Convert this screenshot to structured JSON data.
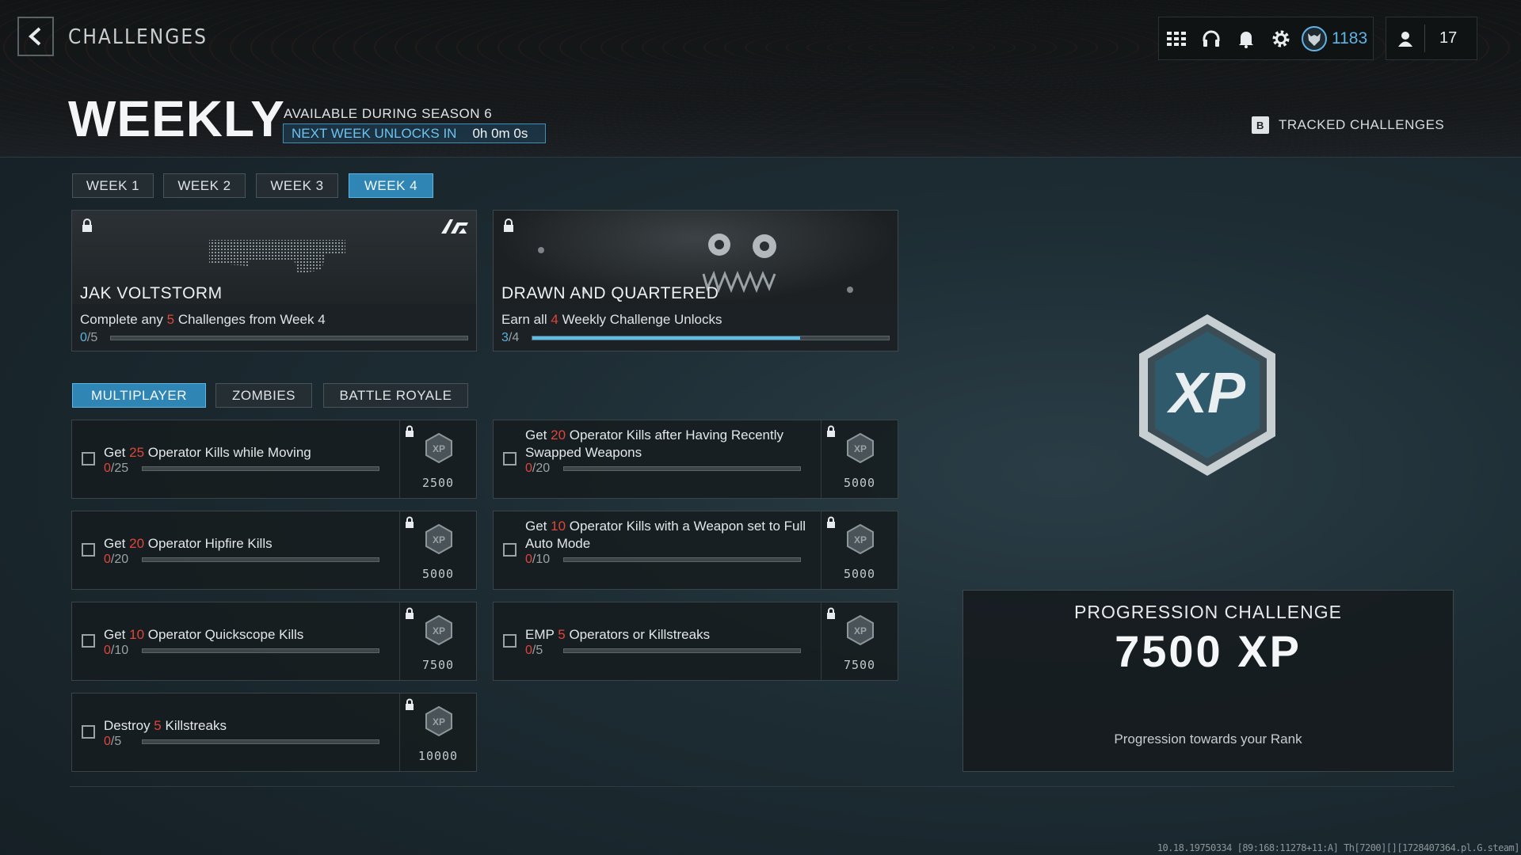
{
  "header": {
    "section_title": "CHALLENGES",
    "currency_value": "1183",
    "player_count": "17"
  },
  "weekly": {
    "title": "WEEKLY",
    "season_text": "AVAILABLE DURING SEASON 6",
    "unlock_label": "NEXT WEEK UNLOCKS IN",
    "unlock_time": "0h 0m 0s",
    "tracked_key": "B",
    "tracked_label": "TRACKED CHALLENGES"
  },
  "week_tabs": [
    "WEEK 1",
    "WEEK 2",
    "WEEK 3",
    "WEEK 4"
  ],
  "active_week": "WEEK 4",
  "unlock_cards": [
    {
      "name": "JAK VOLTSTORM",
      "desc_pre": "Complete any ",
      "desc_num": "5",
      "desc_post": " Challenges from Week 4",
      "cur": "0",
      "total": "/5",
      "progress": 0.0
    },
    {
      "name": "DRAWN AND QUARTERED",
      "desc_pre": "Earn all ",
      "desc_num": "4",
      "desc_post": " Weekly Challenge Unlocks",
      "cur": "3",
      "total": "/4",
      "progress": 0.75
    }
  ],
  "mode_tabs": [
    "MULTIPLAYER",
    "ZOMBIES",
    "BATTLE ROYALE"
  ],
  "active_mode": "MULTIPLAYER",
  "challenges": [
    {
      "pre": "Get ",
      "num": "25",
      "post": " Operator Kills while Moving",
      "cur": "0",
      "total": "/25",
      "xp": "2500"
    },
    {
      "pre": "Get ",
      "num": "20",
      "post": " Operator Kills after Having Recently Swapped Weapons",
      "cur": "0",
      "total": "/20",
      "xp": "5000"
    },
    {
      "pre": "Get ",
      "num": "20",
      "post": " Operator Hipfire Kills",
      "cur": "0",
      "total": "/20",
      "xp": "5000"
    },
    {
      "pre": "Get ",
      "num": "10",
      "post": " Operator Kills with a Weapon set to Full Auto Mode",
      "cur": "0",
      "total": "/10",
      "xp": "5000"
    },
    {
      "pre": "Get ",
      "num": "10",
      "post": " Operator Quickscope Kills",
      "cur": "0",
      "total": "/10",
      "xp": "7500"
    },
    {
      "pre": "EMP ",
      "num": "5",
      "post": " Operators or Killstreaks",
      "cur": "0",
      "total": "/5",
      "xp": "7500"
    },
    {
      "pre": "Destroy ",
      "num": "5",
      "post": " Killstreaks",
      "cur": "0",
      "total": "/5",
      "xp": "10000"
    }
  ],
  "progression": {
    "badge_text": "XP",
    "title": "PROGRESSION CHALLENGE",
    "xp": "7500 XP",
    "subtitle": "Progression towards your Rank"
  },
  "build_string": "10.18.19750334 [89:168:11278+11:A] Th[7200][][1728407364.pl.G.steam]",
  "colors": {
    "accent": "#2f86b4",
    "highlight_number": "#e0453a",
    "progress_fill": "#57c0ea"
  },
  "icons": [
    "back-arrow-icon",
    "grid-icon",
    "headset-icon",
    "bell-icon",
    "gear-icon",
    "wolf-emblem-icon",
    "operator-icon",
    "lock-icon",
    "xp-hex-icon"
  ]
}
